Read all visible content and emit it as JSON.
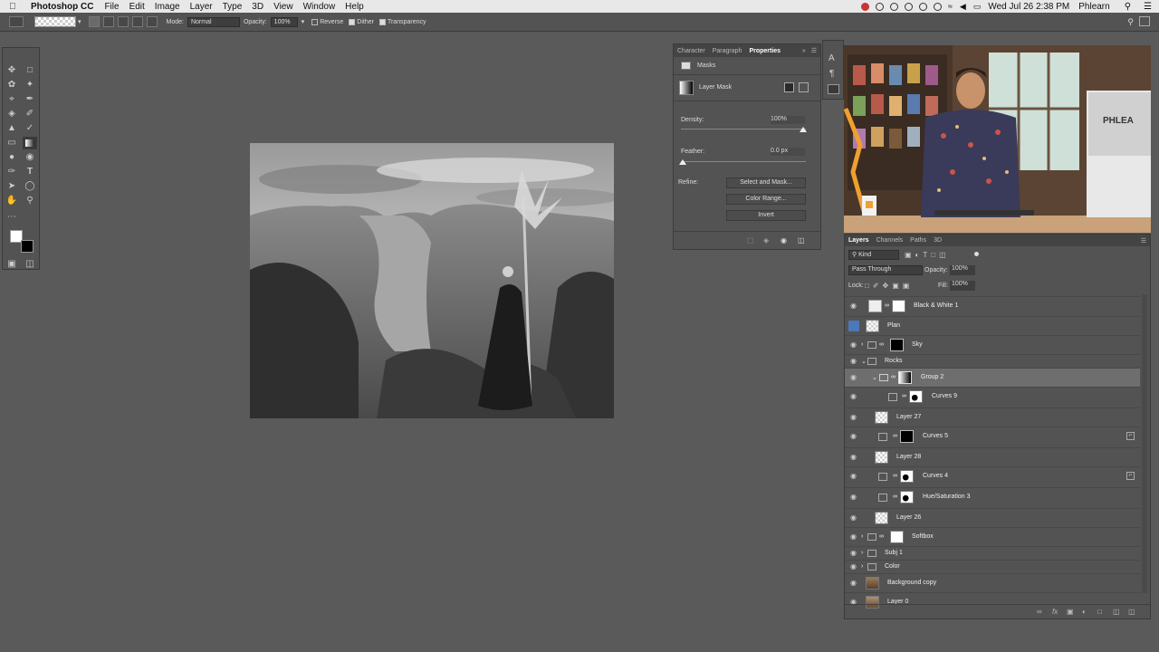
{
  "menubar": {
    "app_name": "Photoshop CC",
    "items": [
      "File",
      "Edit",
      "Image",
      "Layer",
      "Type",
      "3D",
      "View",
      "Window",
      "Help"
    ],
    "clock": "Wed Jul 26  2:38 PM",
    "user": "Phlearn"
  },
  "options": {
    "mode_label": "Mode:",
    "mode_value": "Normal",
    "opacity_label": "Opacity:",
    "opacity_value": "100%",
    "reverse_label": "Reverse",
    "dither_label": "Dither",
    "transparency_label": "Transparency"
  },
  "properties": {
    "tabs": [
      "Character",
      "Paragraph",
      "Properties"
    ],
    "section": "Masks",
    "mask_label": "Layer Mask",
    "density_label": "Density:",
    "density_value": "100%",
    "feather_label": "Feather:",
    "feather_value": "0.0 px",
    "refine_label": "Refine:",
    "select_and_mask": "Select and Mask...",
    "color_range": "Color Range...",
    "invert": "Invert"
  },
  "layers_panel": {
    "tabs": [
      "Layers",
      "Channels",
      "Paths",
      "3D"
    ],
    "filter_kind": "Kind",
    "blend_mode": "Pass Through",
    "opacity_label": "Opacity:",
    "opacity_value": "100%",
    "lock_label": "Lock:",
    "fill_label": "Fill:",
    "fill_value": "100%",
    "layers": [
      {
        "name": "Black & White 1"
      },
      {
        "name": "Plan"
      },
      {
        "name": "Sky"
      },
      {
        "name": "Rocks"
      },
      {
        "name": "Group 2"
      },
      {
        "name": "Curves 9"
      },
      {
        "name": "Layer 27"
      },
      {
        "name": "Curves 5"
      },
      {
        "name": "Layer 28"
      },
      {
        "name": "Curves 4"
      },
      {
        "name": "Hue/Saturation 3"
      },
      {
        "name": "Layer 26"
      },
      {
        "name": "Softbox"
      },
      {
        "name": "Subj 1"
      },
      {
        "name": "Color"
      },
      {
        "name": "Background copy"
      },
      {
        "name": "Layer 0"
      }
    ]
  },
  "video": {
    "sign_text": "PHLEA"
  },
  "colors": {
    "app_bg": "#5a5a5a",
    "panel_bg": "#535353",
    "selected_row": "#6e6e6e",
    "accent": "#4a78b8"
  }
}
